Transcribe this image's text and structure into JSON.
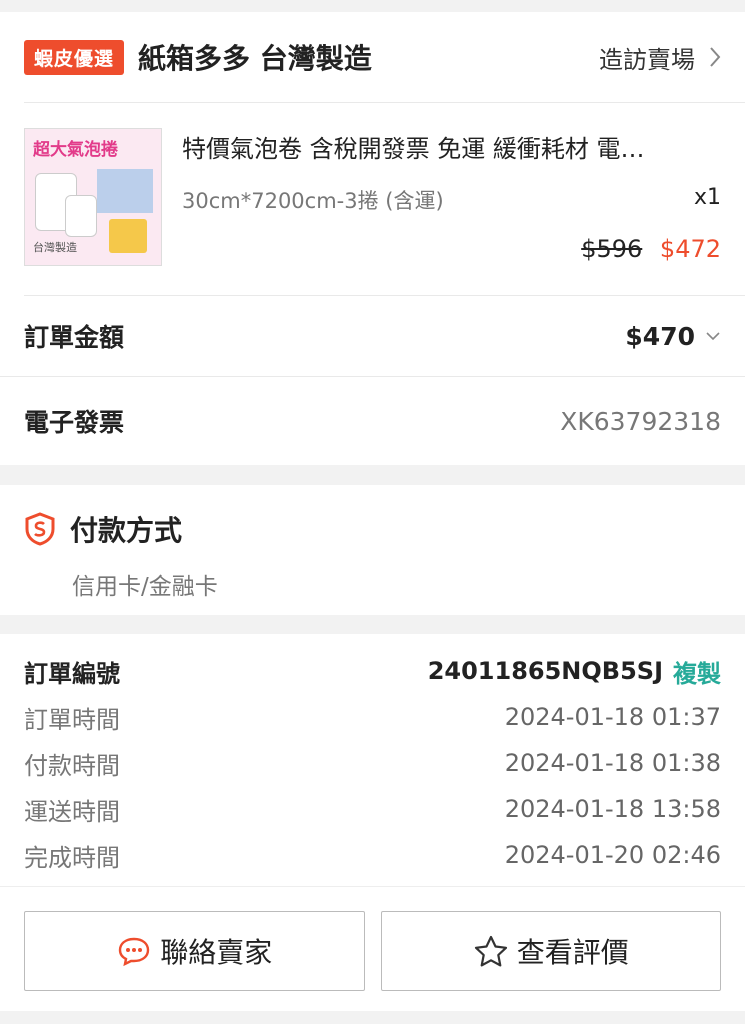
{
  "shop": {
    "badge": "蝦皮優選",
    "name": "紙箱多多 台灣製造",
    "visit_label": "造訪賣場"
  },
  "product": {
    "thumb_title": "超大氣泡捲",
    "thumb_sub": "台灣製造",
    "name": "特價氣泡卷 含稅開發票 免運  緩衝耗材 電…",
    "variant": "30cm*7200cm-3捲 (含運)",
    "quantity": "x1",
    "original_price": "$596",
    "price": "$472"
  },
  "order_amount": {
    "label": "訂單金額",
    "value": "$470"
  },
  "invoice": {
    "label": "電子發票",
    "value": "XK63792318"
  },
  "payment": {
    "title": "付款方式",
    "method": "信用卡/金融卡"
  },
  "order": {
    "number_label": "訂單編號",
    "number": "24011865NQB5SJ",
    "copy_label": "複製",
    "times": [
      {
        "label": "訂單時間",
        "value": "2024-01-18 01:37"
      },
      {
        "label": "付款時間",
        "value": "2024-01-18 01:38"
      },
      {
        "label": "運送時間",
        "value": "2024-01-18 13:58"
      },
      {
        "label": "完成時間",
        "value": "2024-01-20 02:46"
      }
    ]
  },
  "actions": {
    "contact_label": "聯絡賣家",
    "review_label": "查看評價"
  },
  "colors": {
    "accent": "#ee4d2d",
    "copy": "#26aa99"
  }
}
